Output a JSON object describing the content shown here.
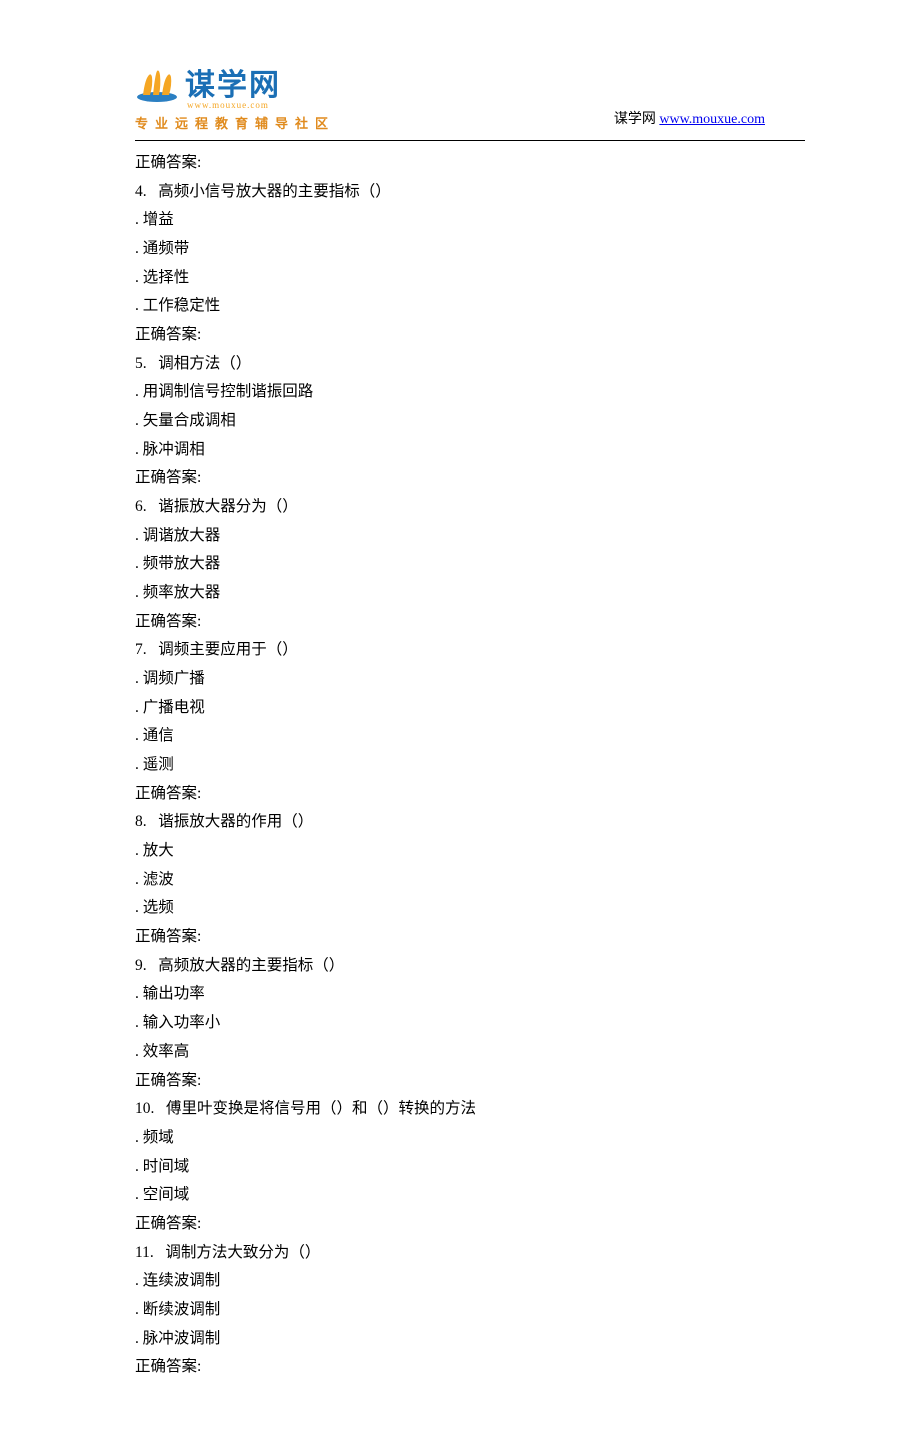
{
  "header": {
    "logo_text": "谋学网",
    "logo_url_small": "www.mouxue.com",
    "logo_subtitle": "专业远程教育辅导社区",
    "right_prefix": "谋学网",
    "right_link": "www.mouxue.com"
  },
  "content_lines": [
    "正确答案:",
    "4.   高频小信号放大器的主要指标（）",
    ". 增益",
    ". 通频带",
    ". 选择性",
    ". 工作稳定性",
    "正确答案:",
    "5.   调相方法（）",
    ". 用调制信号控制谐振回路",
    ". 矢量合成调相",
    ". 脉冲调相",
    "正确答案:",
    "6.   谐振放大器分为（）",
    ". 调谐放大器",
    ". 频带放大器",
    ". 频率放大器",
    "正确答案:",
    "7.   调频主要应用于（）",
    ". 调频广播",
    ". 广播电视",
    ". 通信",
    ". 遥测",
    "正确答案:",
    "8.   谐振放大器的作用（）",
    ". 放大",
    ". 滤波",
    ". 选频",
    "正确答案:",
    "9.   高频放大器的主要指标（）",
    ". 输出功率",
    ". 输入功率小",
    ". 效率高",
    "正确答案:",
    "10.   傅里叶变换是将信号用（）和（）转换的方法",
    ". 频域",
    ". 时间域",
    ". 空间域",
    "正确答案:",
    "11.   调制方法大致分为（）",
    ". 连续波调制",
    ". 断续波调制",
    ". 脉冲波调制",
    "正确答案:"
  ]
}
